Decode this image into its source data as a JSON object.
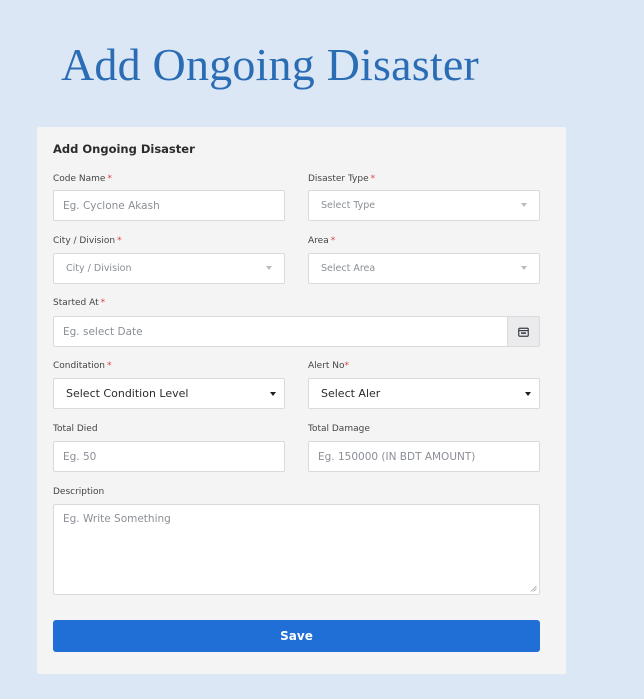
{
  "page": {
    "heading": "Add Ongoing Disaster"
  },
  "form": {
    "title": "Add Ongoing Disaster",
    "code_name": {
      "label": "Code Name",
      "required": "*",
      "placeholder": "Eg. Cyclone Akash"
    },
    "disaster_type": {
      "label": "Disaster Type",
      "required": "*",
      "selected": "Select Type"
    },
    "city_division": {
      "label": "City / Division",
      "required": "*",
      "selected": "City / Division"
    },
    "area": {
      "label": "Area",
      "required": "*",
      "selected": "Select Area"
    },
    "started_at": {
      "label": "Started At",
      "required": "*",
      "placeholder": "Eg. select Date",
      "icon": "calendar-icon"
    },
    "condition": {
      "label": "Conditation",
      "required": "*",
      "selected": "Select Condition Level"
    },
    "alert_no": {
      "label": "Alert No",
      "required": "*",
      "selected": "Select Aler"
    },
    "total_died": {
      "label": "Total Died",
      "placeholder": "Eg. 50"
    },
    "total_damage": {
      "label": "Total Damage",
      "placeholder": "Eg. 150000 (IN BDT AMOUNT)"
    },
    "description": {
      "label": "Description",
      "placeholder": "Eg. Write Something"
    },
    "save_label": "Save"
  },
  "colors": {
    "background": "#dce7f5",
    "heading": "#2a6db5",
    "primary_button": "#1f6fd6",
    "required_mark": "#e23d3d"
  }
}
